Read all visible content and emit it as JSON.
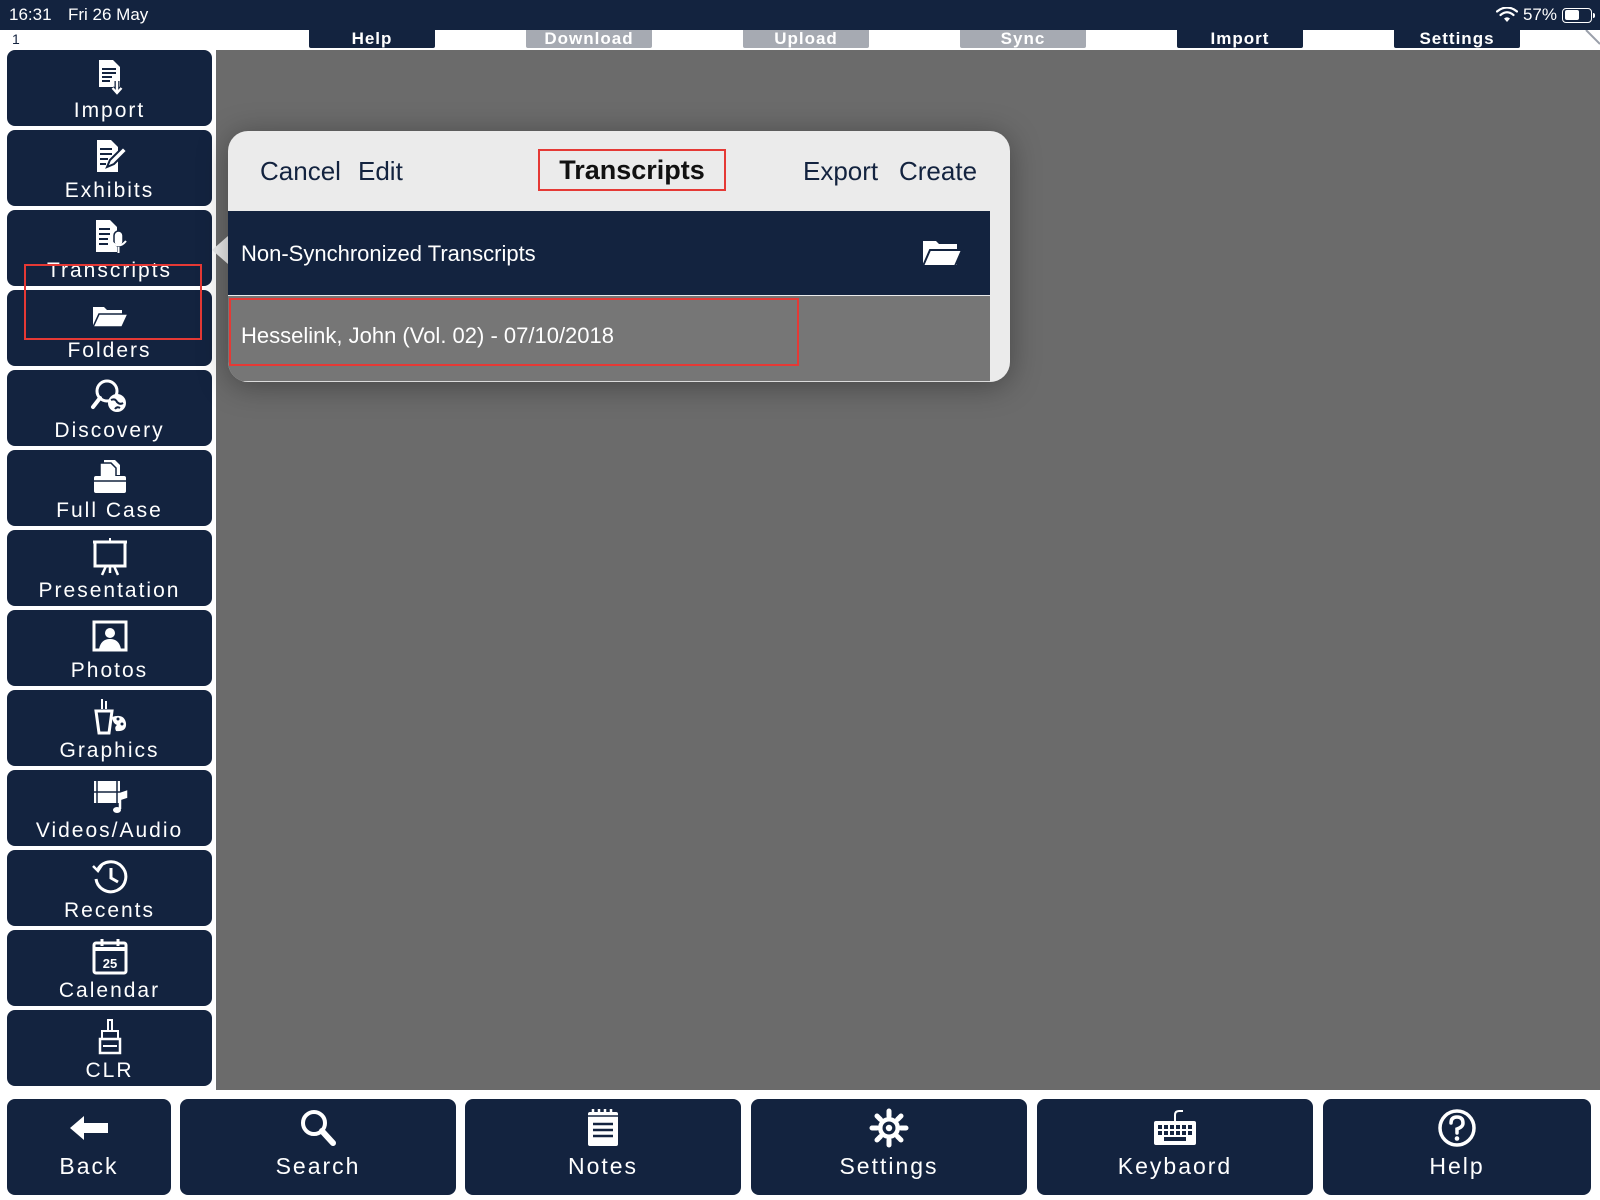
{
  "status": {
    "time": "16:31",
    "date": "Fri 26 May",
    "battery": "57%",
    "battery_level": 0.57
  },
  "topbar": {
    "page_number": "1",
    "buttons": [
      {
        "label": "Help",
        "enabled": true
      },
      {
        "label": "Download",
        "enabled": false
      },
      {
        "label": "Upload",
        "enabled": false
      },
      {
        "label": "Sync",
        "enabled": false
      },
      {
        "label": "Import",
        "enabled": true
      },
      {
        "label": "Settings",
        "enabled": true
      }
    ]
  },
  "sidebar": {
    "items": [
      {
        "label": "Import",
        "icon": "import-document-icon"
      },
      {
        "label": "Exhibits",
        "icon": "exhibits-pen-icon"
      },
      {
        "label": "Transcripts",
        "icon": "transcript-mic-icon",
        "selected": true
      },
      {
        "label": "Folders",
        "icon": "folder-icon"
      },
      {
        "label": "Discovery",
        "icon": "discovery-search-globe-icon"
      },
      {
        "label": "Full Case",
        "icon": "full-case-files-icon"
      },
      {
        "label": "Presentation",
        "icon": "presentation-easel-icon"
      },
      {
        "label": "Photos",
        "icon": "photo-portrait-icon"
      },
      {
        "label": "Graphics",
        "icon": "graphics-palette-icon"
      },
      {
        "label": "Videos/Audio",
        "icon": "video-audio-icon"
      },
      {
        "label": "Recents",
        "icon": "recents-clock-icon"
      },
      {
        "label": "Calendar",
        "icon": "calendar-icon"
      },
      {
        "label": "CLR",
        "icon": "clear-brush-icon"
      }
    ],
    "calendar_day": "25"
  },
  "bottombar": {
    "buttons": [
      {
        "label": "Back",
        "icon": "back-arrow-icon"
      },
      {
        "label": "Search",
        "icon": "search-icon"
      },
      {
        "label": "Notes",
        "icon": "notes-icon"
      },
      {
        "label": "Settings",
        "icon": "gear-icon"
      },
      {
        "label": "Keybaord",
        "icon": "keyboard-icon"
      },
      {
        "label": "Help",
        "icon": "help-icon"
      }
    ]
  },
  "popover": {
    "cancel_label": "Cancel",
    "edit_label": "Edit",
    "title": "Transcripts",
    "export_label": "Export",
    "create_label": "Create",
    "folder_row_label": "Non-Synchronized Transcripts",
    "items": [
      "Hesselink, John (Vol. 02) - 07/10/2018"
    ]
  },
  "colors": {
    "navy": "#13233f",
    "highlight": "#e53935",
    "backdrop": "#6b6b6b",
    "disabled": "#a6aab2"
  }
}
